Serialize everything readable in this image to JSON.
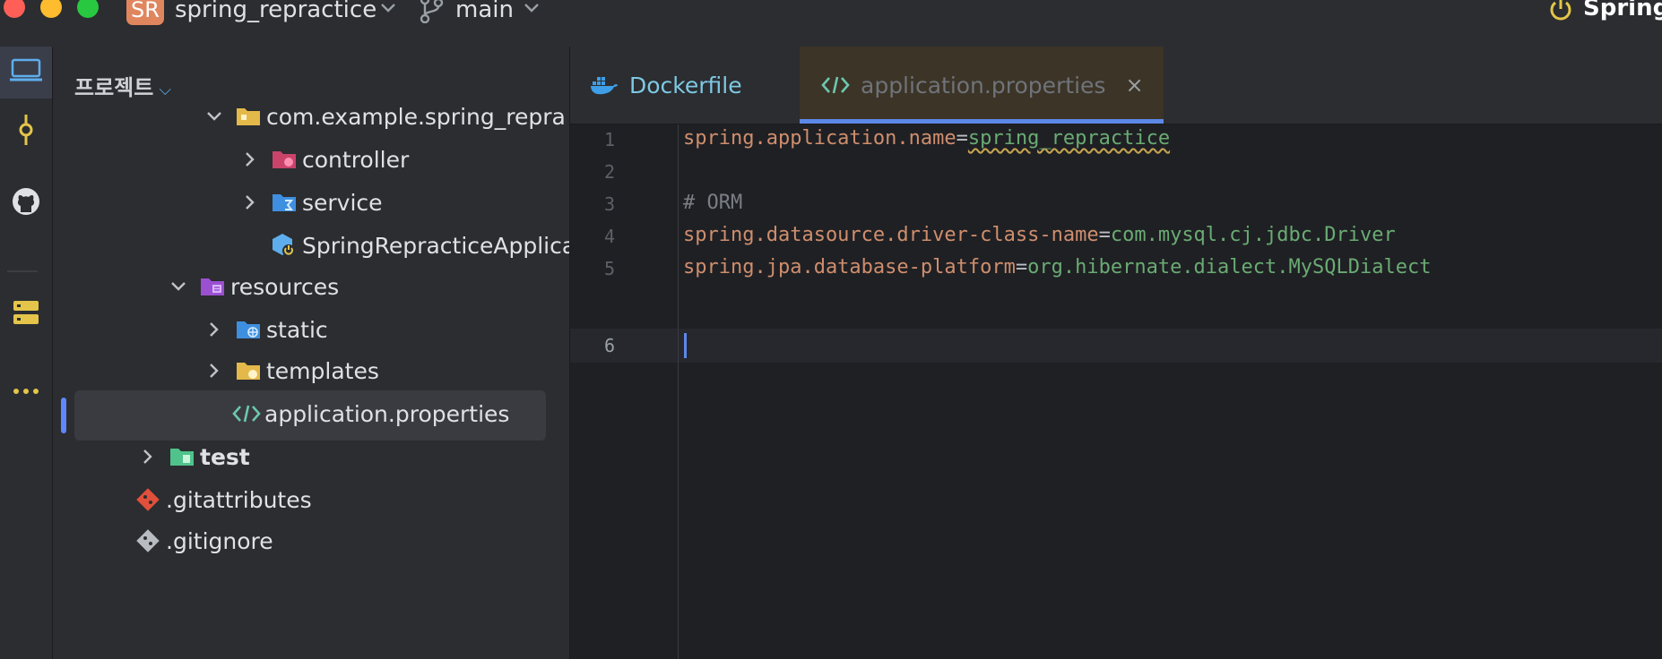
{
  "titlebar": {
    "project_badge": "SR",
    "project_name": "spring_repractice",
    "branch": "main",
    "run_config": "SpringR"
  },
  "activity_bar": {
    "items": [
      "project-icon",
      "commit-icon",
      "github-icon",
      "services-icon",
      "more-icon"
    ]
  },
  "project_panel": {
    "title": "프로젝트",
    "tree": [
      {
        "label": "com.example.spring_repra",
        "type": "package",
        "expanded": true
      },
      {
        "label": "controller",
        "type": "folder",
        "expanded": false
      },
      {
        "label": "service",
        "type": "folder",
        "expanded": false
      },
      {
        "label": "SpringRepracticeApplica",
        "type": "spring-class"
      },
      {
        "label": "resources",
        "type": "resources-folder",
        "expanded": true
      },
      {
        "label": "static",
        "type": "folder",
        "expanded": false
      },
      {
        "label": "templates",
        "type": "folder",
        "expanded": false
      },
      {
        "label": "application.properties",
        "type": "properties-file",
        "selected": true
      },
      {
        "label": "test",
        "type": "test-folder",
        "expanded": false
      },
      {
        "label": ".gitattributes",
        "type": "git-file"
      },
      {
        "label": ".gitignore",
        "type": "git-file"
      }
    ]
  },
  "editor": {
    "tabs": [
      {
        "label": "Dockerfile",
        "active": false
      },
      {
        "label": "application.properties",
        "active": true,
        "close": "×"
      }
    ],
    "lines": [
      {
        "no": "1",
        "key": "spring.application.name",
        "eq": "=",
        "value": "spring_repractice"
      },
      {
        "no": "2"
      },
      {
        "no": "3",
        "comment": "# ORM"
      },
      {
        "no": "4",
        "key": "spring.datasource.driver-class-name",
        "eq": "=",
        "value": "com.mysql.cj.jdbc.Driver"
      },
      {
        "no": "5",
        "key": "spring.jpa.database-platform",
        "eq": "=",
        "value": "org.hibernate.dialect.MySQLDialect"
      },
      {
        "no": "6"
      }
    ],
    "current_line": 6
  },
  "colors": {
    "accent": "#5c88e8",
    "key": "#cf8e6d",
    "value": "#6aab73",
    "comment": "#7a7e85"
  }
}
